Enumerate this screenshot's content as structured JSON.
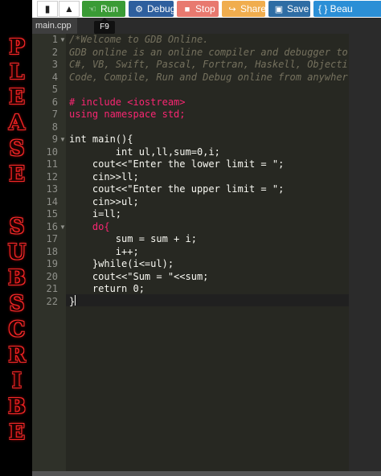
{
  "banner": {
    "word1": [
      "P",
      "L",
      "E",
      "A",
      "S",
      "E"
    ],
    "word2": [
      "S",
      "U",
      "B",
      "S",
      "C",
      "R",
      "I",
      "B",
      "E"
    ]
  },
  "toolbar": {
    "run_label": "Run",
    "debug_label": "Debug",
    "stop_label": "Stop",
    "share_label": "Share",
    "save_label": "Save",
    "beautify_label": "{ } Beau",
    "tooltip": "F9"
  },
  "tab": {
    "filename": "main.cpp"
  },
  "editor": {
    "line_numbers": [
      "1",
      "2",
      "3",
      "4",
      "5",
      "6",
      "7",
      "8",
      "9",
      "10",
      "11",
      "12",
      "13",
      "14",
      "15",
      "16",
      "17",
      "18",
      "19",
      "20",
      "21",
      "22"
    ],
    "lines": [
      "/*Welcome to GDB Online.",
      "GDB online is an online compiler and debugger to",
      "C#, VB, Swift, Pascal, Fortran, Haskell, Objecti",
      "Code, Compile, Run and Debug online from anywher",
      "",
      "# include <iostream>",
      "using namespace std;",
      "",
      "int main(){",
      "        int ul,ll,sum=0,i;",
      "    cout<<\"Enter the lower limit = \";",
      "    cin>>ll;",
      "    cout<<\"Enter the upper limit = \";",
      "    cin>>ul;",
      "    i=ll;",
      "    do{",
      "        sum = sum + i;",
      "        i++;",
      "    }while(i<=ul);",
      "    cout<<\"Sum = \"<<sum;",
      "    return 0;",
      "}"
    ]
  },
  "colors": {
    "run": "#3a9b35",
    "debug": "#2e5f9e",
    "stop": "#e8796f",
    "share": "#f0ad4e",
    "save": "#2e6da4",
    "beautify": "#2b8fd6",
    "banner_text": "#ff2a2a"
  }
}
